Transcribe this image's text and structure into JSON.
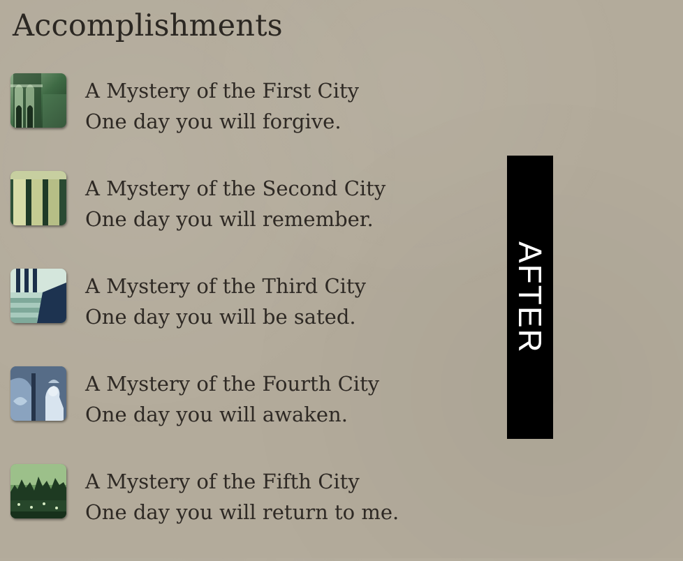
{
  "page": {
    "title": "Accomplishments"
  },
  "accomplishments": [
    {
      "name": "A Mystery of the First City",
      "description": "One day you will forgive.",
      "icon": "arch-icon"
    },
    {
      "name": "A Mystery of the Second City",
      "description": "One day you will remember.",
      "icon": "pillars-icon"
    },
    {
      "name": "A Mystery of the Third City",
      "description": "One day you will be sated.",
      "icon": "stairs-icon"
    },
    {
      "name": "A Mystery of the Fourth City",
      "description": "One day you will awaken.",
      "icon": "statue-icon"
    },
    {
      "name": "A Mystery of the Fifth City",
      "description": "One day you will return to me.",
      "icon": "city-skyline-icon"
    }
  ],
  "side_tab": {
    "label": "AFTER"
  },
  "colors": {
    "background": "#b3ab9b",
    "text": "#2e2924",
    "tab_background": "#000000",
    "tab_text": "#ffffff"
  }
}
